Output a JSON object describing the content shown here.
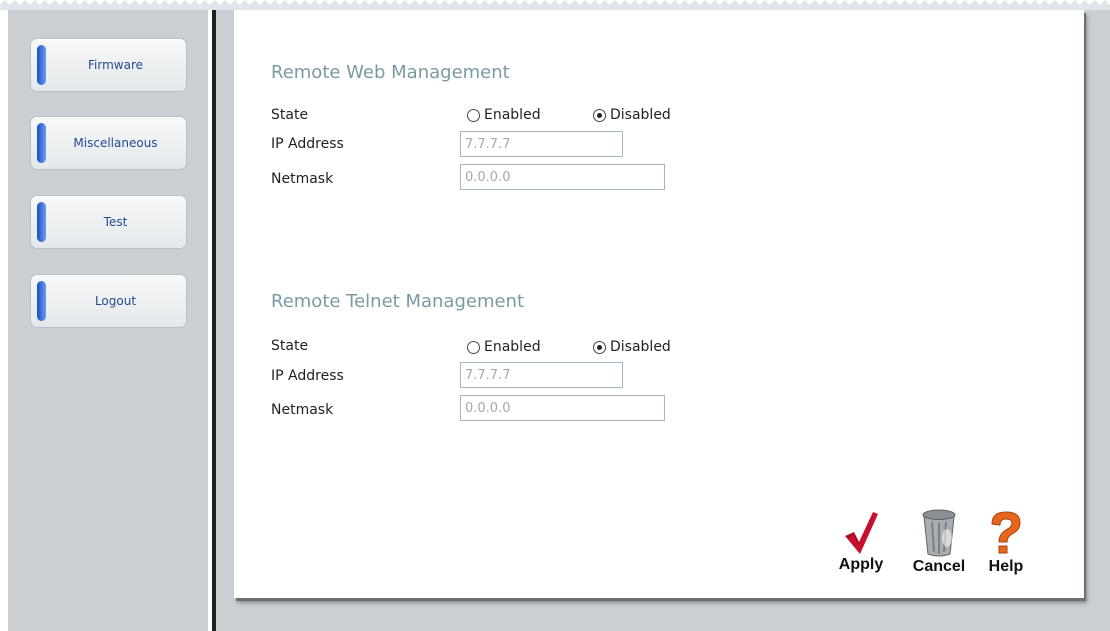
{
  "sidebar": {
    "items": [
      {
        "label": "Firmware"
      },
      {
        "label": "Miscellaneous"
      },
      {
        "label": "Test"
      },
      {
        "label": "Logout"
      }
    ]
  },
  "web": {
    "title": "Remote Web Management",
    "state_label": "State",
    "enabled_label": "Enabled",
    "disabled_label": "Disabled",
    "selected": "Disabled",
    "ip_label": "IP Address",
    "ip_value": "7.7.7.7",
    "netmask_label": "Netmask",
    "netmask_value": "0.0.0.0"
  },
  "telnet": {
    "title": "Remote Telnet Management",
    "state_label": "State",
    "enabled_label": "Enabled",
    "disabled_label": "Disabled",
    "selected": "Disabled",
    "ip_label": "IP Address",
    "ip_value": "7.7.7.7",
    "netmask_label": "Netmask",
    "netmask_value": "0.0.0.0"
  },
  "actions": {
    "apply_label": "Apply",
    "cancel_label": "Cancel",
    "help_label": "Help"
  },
  "icons": {
    "apply": "checkmark-icon",
    "cancel": "trash-can-icon",
    "help": "question-mark-icon"
  },
  "colors": {
    "check": "#c8102e",
    "help": "#e8651c",
    "title": "#7a9aa3",
    "nav_accent": "#2b5fd4"
  }
}
